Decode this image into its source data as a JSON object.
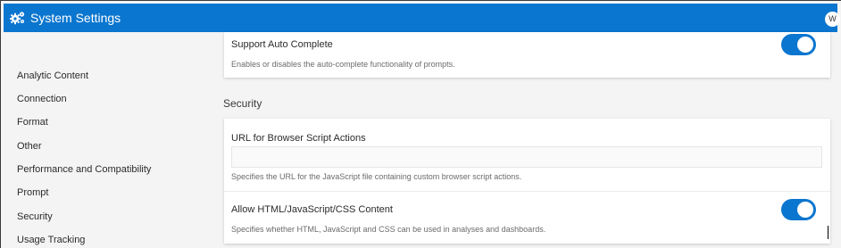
{
  "header": {
    "title": "System Settings",
    "icon": "gears-icon",
    "user_initial": "W",
    "color": "#0b76cf"
  },
  "sidebar": {
    "items": [
      {
        "label": "Analytic Content"
      },
      {
        "label": "Connection"
      },
      {
        "label": "Format"
      },
      {
        "label": "Other"
      },
      {
        "label": "Performance and Compatibility"
      },
      {
        "label": "Prompt"
      },
      {
        "label": "Security"
      },
      {
        "label": "Usage Tracking"
      }
    ]
  },
  "settings": {
    "auto_complete": {
      "label": "Support Auto Complete",
      "description": "Enables or disables the auto-complete functionality of prompts.",
      "enabled": true
    }
  },
  "security": {
    "section_title": "Security",
    "url_field": {
      "label": "URL for Browser Script Actions",
      "value": "",
      "description": "Specifies the URL for the JavaScript file containing custom browser script actions."
    },
    "html_content": {
      "label": "Allow HTML/JavaScript/CSS Content",
      "description": "Specifies whether HTML, JavaScript and CSS can be used in analyses and dashboards.",
      "enabled": true
    }
  }
}
